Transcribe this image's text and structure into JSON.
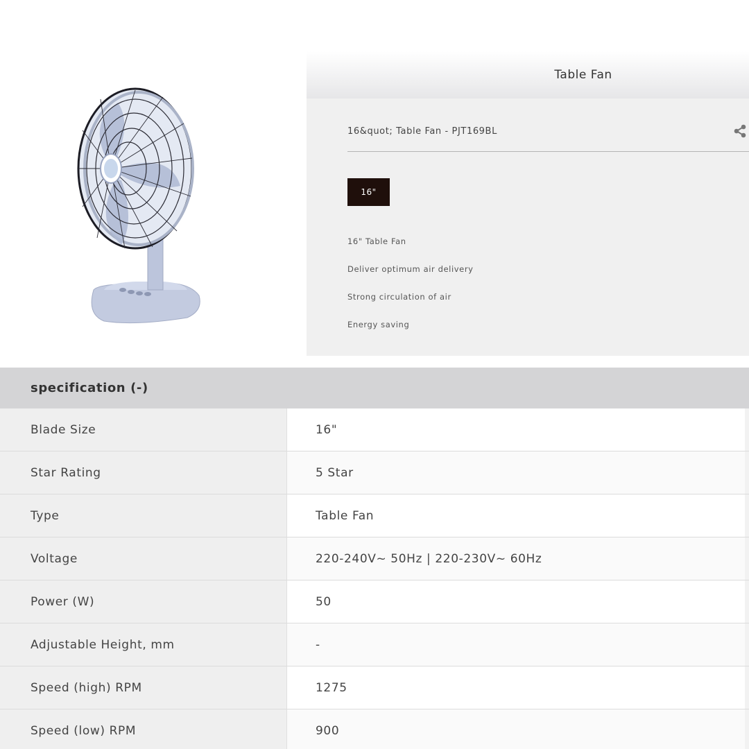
{
  "product": {
    "image_icon": "table-fan-image",
    "category_title": "Table Fan",
    "name": "16&quot; Table Fan - PJT169BL",
    "size_option": "16\"",
    "features": [
      "16\" Table Fan",
      "Deliver optimum air delivery",
      "Strong circulation of air",
      "Energy saving"
    ],
    "share_icon": "share-icon"
  },
  "specification": {
    "header": "specification (-)",
    "rows": [
      {
        "label": "Blade Size",
        "value": "16\""
      },
      {
        "label": "Star Rating",
        "value": "5 Star"
      },
      {
        "label": "Type",
        "value": "Table Fan"
      },
      {
        "label": "Voltage",
        "value": "220-240V~ 50Hz | 220-230V~ 60Hz"
      },
      {
        "label": "Power (W)",
        "value": "50"
      },
      {
        "label": "Adjustable Height, mm",
        "value": "-"
      },
      {
        "label": "Speed (high) RPM",
        "value": "1275"
      },
      {
        "label": "Speed (low) RPM",
        "value": "900"
      }
    ]
  },
  "colors": {
    "size_button_bg": "#1f0f0b",
    "spec_header_bg": "#d4d4d6",
    "panel_bg": "#f0f0f0"
  }
}
